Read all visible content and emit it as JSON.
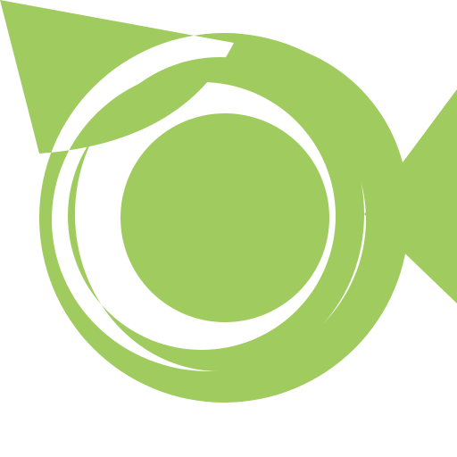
{
  "logo": {
    "icon": "green-swirl-circle-logo",
    "color": "#a0cb5f",
    "background": "#ffffff"
  }
}
